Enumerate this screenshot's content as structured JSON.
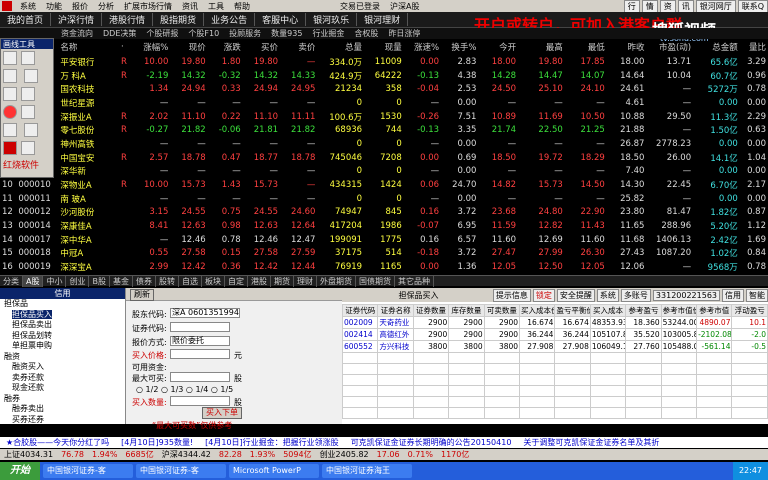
{
  "menu": {
    "items": [
      "系统",
      "功能",
      "报价",
      "分析",
      "扩展市场行情",
      "资讯",
      "工具",
      "帮助"
    ],
    "center": "交易已登录",
    "account": "沪深A股",
    "right": [
      "行",
      "情",
      "资",
      "讯",
      "银河网厅",
      "联系Q"
    ]
  },
  "nav": [
    "我的首页",
    "沪深行情",
    "港股行情",
    "股指期货",
    "业务公告",
    "客服中心",
    "银河玖乐",
    "银河理财"
  ],
  "subnav": [
    "资金流向",
    "DDE决策",
    "个股研报",
    "个股F10",
    "投顾服务",
    "数量935",
    "行业掘金",
    "含权股",
    "昨日涨停"
  ],
  "promo": "开户或转户，可加入港客户群",
  "watermark": {
    "main": "搜狐视频",
    "sub": "tv.sohu.com"
  },
  "toolpanel": {
    "title": "画线工具",
    "label": "红烧软件"
  },
  "table": {
    "headers": [
      "",
      "代码",
      "名称",
      "·",
      "涨幅%",
      "现价",
      "涨跌",
      "买价",
      "卖价",
      "总量",
      "现量",
      "涨速%",
      "换手%",
      "今开",
      "最高",
      "最低",
      "昨收",
      "市盈(动)",
      "总金额",
      "量比"
    ],
    "rows": [
      [
        "1",
        "000001",
        "平安银行",
        "R",
        "10.00",
        "19.80",
        "1.80",
        "19.80",
        "—",
        "334.0万",
        "11009",
        "0.00",
        "2.83",
        "18.00",
        "19.80",
        "17.85",
        "18.00",
        "13.71",
        "65.6亿",
        "3.29"
      ],
      [
        "2",
        "000002",
        "万 科A",
        "R",
        "-2.19",
        "14.32",
        "-0.32",
        "14.32",
        "14.33",
        "424.9万",
        "64222",
        "-0.13",
        "4.38",
        "14.28",
        "14.47",
        "14.07",
        "14.64",
        "10.04",
        "60.7亿",
        "0.96"
      ],
      [
        "3",
        "000003",
        "国农科技",
        "",
        "1.34",
        "24.94",
        "0.33",
        "24.94",
        "24.95",
        "21234",
        "358",
        "-0.04",
        "2.53",
        "24.50",
        "25.10",
        "24.10",
        "24.61",
        "—",
        "5272万",
        "0.78"
      ],
      [
        "4",
        "000004",
        "世纪星源",
        "",
        "—",
        "—",
        "—",
        "—",
        "—",
        "0",
        "0",
        "—",
        "0.00",
        "—",
        "—",
        "—",
        "4.61",
        "—",
        "0.00",
        "0.00"
      ],
      [
        "5",
        "000005",
        "深振业A",
        "R",
        "2.02",
        "11.10",
        "0.22",
        "11.10",
        "11.11",
        "100.6万",
        "1530",
        "-0.26",
        "7.51",
        "10.89",
        "11.69",
        "10.50",
        "10.88",
        "29.50",
        "11.3亿",
        "2.29"
      ],
      [
        "6",
        "000006",
        "零七股份",
        "R",
        "-0.27",
        "21.82",
        "-0.06",
        "21.81",
        "21.82",
        "68936",
        "744",
        "-0.13",
        "3.35",
        "21.74",
        "22.50",
        "21.25",
        "21.88",
        "—",
        "1.50亿",
        "0.63"
      ],
      [
        "7",
        "000007",
        "神州高铁",
        "",
        "—",
        "—",
        "—",
        "—",
        "—",
        "0",
        "0",
        "—",
        "0.00",
        "—",
        "—",
        "—",
        "26.87",
        "2778.23",
        "0.00",
        "0.00"
      ],
      [
        "8",
        "000008",
        "中国宝安",
        "R",
        "2.57",
        "18.78",
        "0.47",
        "18.77",
        "18.78",
        "745046",
        "7208",
        "0.00",
        "0.69",
        "18.50",
        "19.72",
        "18.29",
        "18.50",
        "26.00",
        "14.1亿",
        "1.04"
      ],
      [
        "9",
        "000009",
        "深华新",
        "",
        "—",
        "—",
        "—",
        "—",
        "—",
        "0",
        "0",
        "—",
        "0.00",
        "—",
        "—",
        "—",
        "7.40",
        "—",
        "0.00",
        "0.00"
      ],
      [
        "10",
        "000010",
        "深物业A",
        "R",
        "10.00",
        "15.73",
        "1.43",
        "15.73",
        "—",
        "434315",
        "1424",
        "0.06",
        "24.70",
        "14.82",
        "15.73",
        "14.50",
        "14.30",
        "22.45",
        "6.70亿",
        "2.17"
      ],
      [
        "11",
        "000011",
        "南 玻A",
        "",
        "—",
        "—",
        "—",
        "—",
        "—",
        "0",
        "0",
        "—",
        "0.00",
        "—",
        "—",
        "—",
        "25.82",
        "—",
        "0.00",
        "0.00"
      ],
      [
        "12",
        "000012",
        "沙河股份",
        "",
        "3.15",
        "24.55",
        "0.75",
        "24.55",
        "24.60",
        "74947",
        "845",
        "0.16",
        "3.72",
        "23.68",
        "24.80",
        "22.90",
        "23.80",
        "81.47",
        "1.82亿",
        "0.87"
      ],
      [
        "13",
        "000014",
        "深康佳A",
        "",
        "8.41",
        "12.63",
        "0.98",
        "12.63",
        "12.64",
        "417204",
        "1986",
        "-0.07",
        "6.95",
        "11.59",
        "12.82",
        "11.43",
        "11.65",
        "288.96",
        "5.20亿",
        "1.12"
      ],
      [
        "14",
        "000017",
        "深中华A",
        "",
        "—",
        "12.46",
        "0.78",
        "12.46",
        "12.47",
        "199091",
        "1775",
        "0.16",
        "6.57",
        "11.60",
        "12.69",
        "11.60",
        "11.68",
        "1406.13",
        "2.42亿",
        "1.69"
      ],
      [
        "15",
        "000018",
        "中冠A",
        "",
        "0.55",
        "27.58",
        "0.15",
        "27.58",
        "27.59",
        "37175",
        "514",
        "-0.18",
        "3.72",
        "27.47",
        "27.99",
        "26.30",
        "27.43",
        "1087.20",
        "1.02亿",
        "0.84"
      ],
      [
        "16",
        "000019",
        "深深宝A",
        "",
        "2.99",
        "12.42",
        "0.36",
        "12.42",
        "12.44",
        "76919",
        "1165",
        "0.00",
        "1.36",
        "12.05",
        "12.50",
        "12.05",
        "12.06",
        "—",
        "9568万",
        "0.78"
      ]
    ],
    "colors": [
      "wht",
      "wht",
      "yel",
      "red",
      "x",
      "x",
      "x",
      "x",
      "x",
      "yel",
      "yel",
      "x",
      "wht",
      "x",
      "x",
      "x",
      "wht",
      "wht",
      "cyn",
      "wht"
    ]
  },
  "tabs": [
    "分类",
    "A股",
    "中小",
    "创业",
    "B股",
    "基金",
    "债券",
    "股转",
    "自选",
    "板块",
    "自定",
    "港股",
    "期货",
    "理财",
    "外盘期货",
    "国债期货",
    "其它品种"
  ],
  "left": {
    "title": "信用",
    "items": [
      {
        "t": "担保品",
        "lv": 0
      },
      {
        "t": "担保品买入",
        "lv": 1,
        "sel": true
      },
      {
        "t": "担保品卖出",
        "lv": 1
      },
      {
        "t": "担保品划转",
        "lv": 1
      },
      {
        "t": "单担票申购",
        "lv": 1
      },
      {
        "t": "融资",
        "lv": 0
      },
      {
        "t": "融资买入",
        "lv": 1
      },
      {
        "t": "卖券还款",
        "lv": 1
      },
      {
        "t": "现金还款",
        "lv": 1
      },
      {
        "t": "融券",
        "lv": 0
      },
      {
        "t": "融券卖出",
        "lv": 1
      },
      {
        "t": "买券还券",
        "lv": 1
      },
      {
        "t": "现券还券",
        "lv": 1
      }
    ]
  },
  "order": {
    "refresh": "刷新",
    "account_label": "股东代码:",
    "account_value": "深A 0601351994",
    "code_label": "证券代码:",
    "type_label": "报价方式:",
    "type_value": "限价委托",
    "price_label": "买入价格:",
    "price_unit": "元",
    "avail_label": "可用资金:",
    "max_label": "最大可买:",
    "max_unit": "股",
    "ratios": [
      "1/2",
      "1/3",
      "1/4",
      "1/5"
    ],
    "qty_label": "买入数量:",
    "qty_unit": "股",
    "submit": "买入下单",
    "hint": "“最大可买数”仅供参考"
  },
  "right": {
    "title": "担保品买入",
    "buttons": [
      "提示信息",
      "锁定",
      "安全提醒",
      "系统",
      "多账号"
    ],
    "acct": "331200221563",
    "acct_type": "信用",
    "acct_name": "智能",
    "headers": [
      "证券代码",
      "证券名称",
      "证券数量",
      "库存数量",
      "可卖数量",
      "买入成本价",
      "盈亏平衡价",
      "买入成本",
      "参考盈亏",
      "参考市值价格",
      "参考市值",
      "浮动盈亏"
    ],
    "rows": [
      [
        "002009",
        "天奇药业",
        "2900",
        "2900",
        "2900",
        "16.674",
        "16.674",
        "48353.93",
        "18.360",
        "53244.00",
        "4890.07",
        "10.1"
      ],
      [
        "002414",
        "高德红外",
        "2900",
        "2900",
        "2900",
        "36.244",
        "36.244",
        "105107.88",
        "35.520",
        "103005.80",
        "-2102.08",
        "-2.0"
      ],
      [
        "600552",
        "方兴科技",
        "3800",
        "3800",
        "3800",
        "27.908",
        "27.908",
        "106049.14",
        "27.760",
        "105488.00",
        "-561.14",
        "-0.5"
      ]
    ]
  },
  "ticker": [
    "★合胶股——今天你分红了吗",
    "[4月10日]935数量!",
    "[4月10日]行业掘金：把握行业领涨股",
    "可克凯保证金证券长期明确的公告20150410",
    "关于调整可克凯保证金证券名单及其折"
  ],
  "status": [
    "上证4034.31",
    "76.78",
    "1.94%",
    "6685亿",
    "沪深4344.42",
    "82.28",
    "1.93%",
    "5094亿",
    "创业2405.82",
    "17.06",
    "0.71%",
    "1170亿"
  ],
  "taskbar": {
    "start": "开始",
    "tasks": [
      "中国银河证券-客",
      "中国银河证券-客",
      "Microsoft PowerP",
      "中国银河证券海王"
    ],
    "clock": "22:47"
  }
}
